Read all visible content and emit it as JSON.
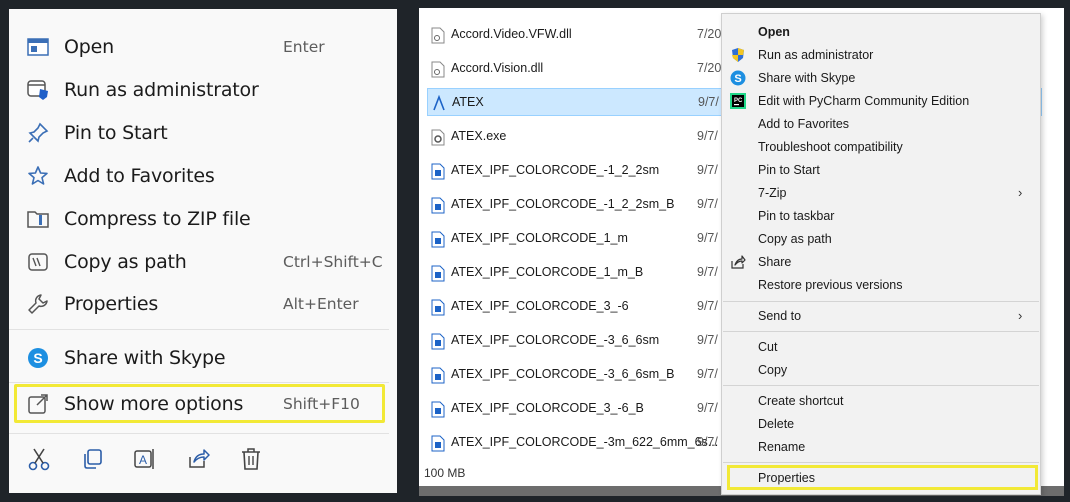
{
  "left_menu": {
    "items": [
      {
        "label": "Open",
        "shortcut": "Enter"
      },
      {
        "label": "Run as administrator",
        "shortcut": ""
      },
      {
        "label": "Pin to Start",
        "shortcut": ""
      },
      {
        "label": "Add to Favorites",
        "shortcut": ""
      },
      {
        "label": "Compress to ZIP file",
        "shortcut": ""
      },
      {
        "label": "Copy as path",
        "shortcut": "Ctrl+Shift+C"
      },
      {
        "label": "Properties",
        "shortcut": "Alt+Enter"
      },
      {
        "label": "Share with Skype",
        "shortcut": ""
      },
      {
        "label": "Show more options",
        "shortcut": "Shift+F10"
      }
    ],
    "actions": [
      "cut-icon",
      "copy-icon",
      "rename-icon",
      "share-icon",
      "delete-icon"
    ],
    "highlight_color": "#f2e936"
  },
  "explorer": {
    "files": [
      {
        "name": "Accord.Video.VFW.dll",
        "date": "7/20"
      },
      {
        "name": "Accord.Vision.dll",
        "date": "7/20"
      },
      {
        "name": "ATEX",
        "date": "9/7/"
      },
      {
        "name": "ATEX.exe",
        "date": "9/7/"
      },
      {
        "name": "ATEX_IPF_COLORCODE_-1_2_2sm",
        "date": "9/7/"
      },
      {
        "name": "ATEX_IPF_COLORCODE_-1_2_2sm_B",
        "date": "9/7/"
      },
      {
        "name": "ATEX_IPF_COLORCODE_1_m",
        "date": "9/7/"
      },
      {
        "name": "ATEX_IPF_COLORCODE_1_m_B",
        "date": "9/7/"
      },
      {
        "name": "ATEX_IPF_COLORCODE_3_-6",
        "date": "9/7/"
      },
      {
        "name": "ATEX_IPF_COLORCODE_-3_6_6sm",
        "date": "9/7/"
      },
      {
        "name": "ATEX_IPF_COLORCODE_-3_6_6sm_B",
        "date": "9/7/"
      },
      {
        "name": "ATEX_IPF_COLORCODE_3_-6_B",
        "date": "9/7/"
      },
      {
        "name": "ATEX_IPF_COLORCODE_-3m_622_6mm_6s...",
        "date": "9/7/"
      }
    ],
    "status_size": "100 MB",
    "selection_color": "#cce8ff"
  },
  "classic_menu": {
    "items": [
      {
        "label": "Open"
      },
      {
        "label": "Run as administrator"
      },
      {
        "label": "Share with Skype"
      },
      {
        "label": "Edit with PyCharm Community Edition"
      },
      {
        "label": "Add to Favorites"
      },
      {
        "label": "Troubleshoot compatibility"
      },
      {
        "label": "Pin to Start"
      },
      {
        "label": "7-Zip"
      },
      {
        "label": "Pin to taskbar"
      },
      {
        "label": "Copy as path"
      },
      {
        "label": "Share"
      },
      {
        "label": "Restore previous versions"
      },
      {
        "label": "Send to"
      },
      {
        "label": "Cut"
      },
      {
        "label": "Copy"
      },
      {
        "label": "Create shortcut"
      },
      {
        "label": "Delete"
      },
      {
        "label": "Rename"
      },
      {
        "label": "Properties"
      }
    ],
    "submenu_arrow": "›"
  }
}
